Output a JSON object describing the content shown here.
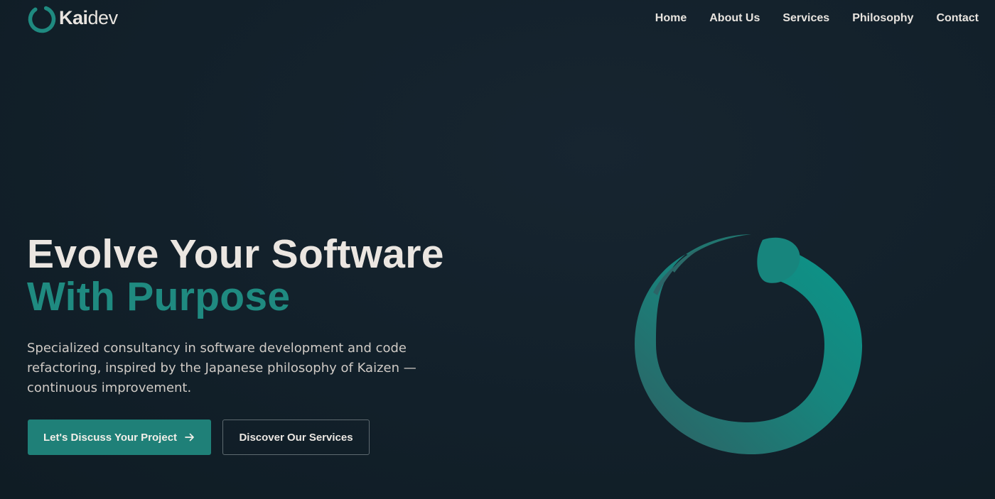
{
  "brand": {
    "name_bold": "Kai",
    "name_light": "dev",
    "logo_icon": "enso-ring-icon",
    "accent_color": "#1f8a80"
  },
  "nav": {
    "items": [
      {
        "label": "Home"
      },
      {
        "label": "About Us"
      },
      {
        "label": "Services"
      },
      {
        "label": "Philosophy"
      },
      {
        "label": "Contact"
      }
    ]
  },
  "hero": {
    "headline_line1": "Evolve Your Software",
    "headline_line2": "With Purpose",
    "subtitle": "Specialized consultancy in software development and code refactoring, inspired by the Japanese philosophy of Kaizen — continuous improvement.",
    "primary_cta": "Let's Discuss Your Project",
    "primary_cta_icon": "arrow-right-icon",
    "secondary_cta": "Discover Our Services",
    "illustration_icon": "enso-circle-icon"
  },
  "colors": {
    "background": "#12202a",
    "accent": "#1f8a80",
    "text": "#e8e4df"
  }
}
